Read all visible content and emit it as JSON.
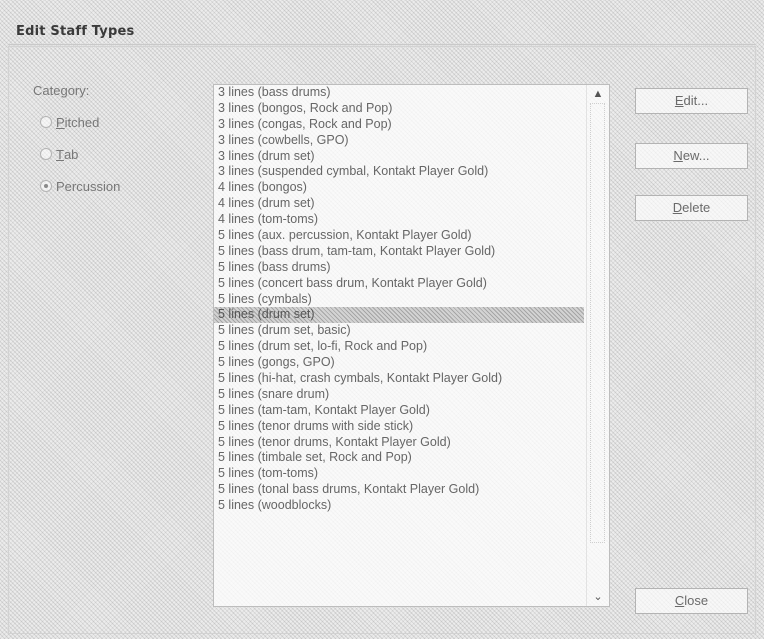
{
  "window": {
    "title": "Edit Staff Types"
  },
  "category": {
    "label": "Category:",
    "options": [
      {
        "accel": "P",
        "rest": "itched",
        "checked": false
      },
      {
        "accel": "T",
        "rest": "ab",
        "checked": false
      },
      {
        "accel": "",
        "rest": "Percussion",
        "checked": true
      }
    ]
  },
  "staff_types": {
    "selected_index": 14,
    "items": [
      "3 lines (bass drums)",
      "3 lines (bongos, Rock and Pop)",
      "3 lines (congas, Rock and Pop)",
      "3 lines (cowbells, GPO)",
      "3 lines (drum set)",
      "3 lines (suspended cymbal, Kontakt Player Gold)",
      "4 lines (bongos)",
      "4 lines (drum set)",
      "4 lines (tom-toms)",
      "5 lines (aux. percussion, Kontakt Player Gold)",
      "5 lines (bass drum, tam-tam, Kontakt Player Gold)",
      "5 lines (bass drums)",
      "5 lines (concert bass drum, Kontakt Player Gold)",
      "5 lines (cymbals)",
      "5 lines (drum set)",
      "5 lines (drum set, basic)",
      "5 lines (drum set, lo-fi, Rock and Pop)",
      "5 lines (gongs, GPO)",
      "5 lines (hi-hat, crash cymbals, Kontakt Player Gold)",
      "5 lines (snare drum)",
      "5 lines (tam-tam, Kontakt Player Gold)",
      "5 lines (tenor drums with side stick)",
      "5 lines (tenor drums, Kontakt Player Gold)",
      "5 lines (timbale set, Rock and Pop)",
      "5 lines (tom-toms)",
      "5 lines (tonal bass drums, Kontakt Player Gold)",
      "5 lines (woodblocks)"
    ]
  },
  "buttons": {
    "edit": {
      "accel": "E",
      "rest": "dit..."
    },
    "new": {
      "accel": "N",
      "rest": "ew..."
    },
    "delete": {
      "accel": "D",
      "rest": "elete"
    },
    "close": {
      "accel": "C",
      "rest": "lose"
    }
  },
  "scrollbar": {
    "up_icon": "chevron-up-icon",
    "down_icon": "chevron-down-icon"
  }
}
